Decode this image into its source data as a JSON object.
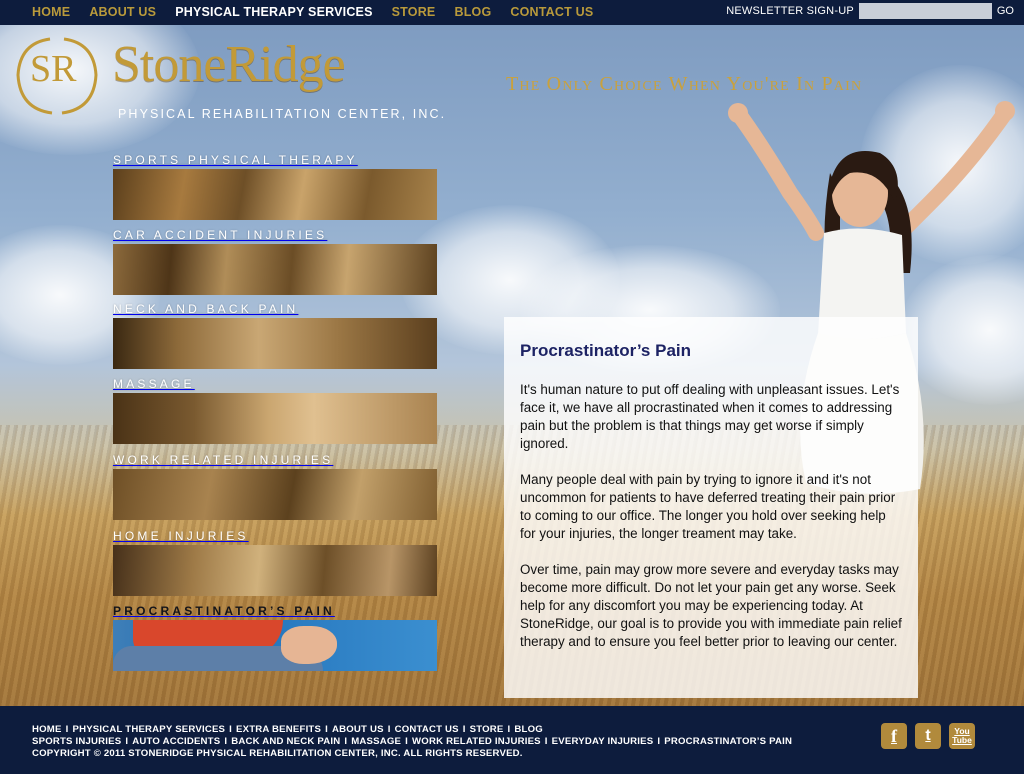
{
  "nav": {
    "items": [
      {
        "label": "HOME",
        "active": false
      },
      {
        "label": "ABOUT US",
        "active": false
      },
      {
        "label": "PHYSICAL THERAPY SERVICES",
        "active": true
      },
      {
        "label": "STORE",
        "active": false
      },
      {
        "label": "BLOG",
        "active": false
      },
      {
        "label": "CONTACT US",
        "active": false
      }
    ],
    "newsletter_label": "NEWSLETTER SIGN-UP",
    "newsletter_value": "",
    "go_label": "GO"
  },
  "brand": {
    "monogram": "SR",
    "name": "StoneRidge",
    "subtitle": "PHYSICAL REHABILITATION CENTER, INC.",
    "tagline": "The Only Choice When You're In Pain"
  },
  "services": [
    {
      "label": "SPORTS PHYSICAL THERAPY",
      "active": false
    },
    {
      "label": "CAR ACCIDENT INJURIES",
      "active": false
    },
    {
      "label": "NECK AND BACK PAIN",
      "active": false
    },
    {
      "label": "MASSAGE",
      "active": false
    },
    {
      "label": "WORK RELATED INJURIES",
      "active": false
    },
    {
      "label": "HOME INJURIES",
      "active": false
    },
    {
      "label": "PROCRASTINATOR’S PAIN",
      "active": true
    }
  ],
  "content": {
    "title": "Procrastinator’s Pain",
    "paragraphs": [
      "It's human nature to put off dealing with unpleasant issues. Let's face it, we have all procrastinated when it comes to addressing pain but the problem is that things may get worse if simply ignored.",
      "Many people deal with pain by trying to ignore it and it's not uncommon for patients to have deferred treating their pain prior to coming to our office. The longer you hold over seeking help for your injuries, the longer treament may take.",
      "Over time, pain may grow more severe and everyday tasks may become more difficult. Do not let your pain get any worse. Seek help for any discomfort you may be experiencing today. At StoneRidge, our goal is to provide you with immediate pain relief therapy and to ensure you feel better prior to leaving our center."
    ]
  },
  "footer": {
    "links_row1": [
      "HOME",
      "PHYSICAL THERAPY SERVICES",
      "EXTRA BENEFITS",
      "ABOUT US",
      "CONTACT US",
      "STORE",
      "BLOG"
    ],
    "links_row2": [
      "SPORTS INJURIES",
      "AUTO ACCIDENTS",
      "BACK AND NECK PAIN",
      "MASSAGE",
      "WORK RELATED INJURIES",
      "EVERYDAY INJURIES",
      "PROCRASTINATOR’S PAIN"
    ],
    "separator": "I",
    "copyright": "COPYRIGHT © 2011 STONERIDGE PHYSICAL REHABILITATION CENTER, INC. ALL RIGHTS RESERVED.",
    "social": [
      {
        "name": "facebook-icon",
        "glyph": "f"
      },
      {
        "name": "twitter-icon",
        "glyph": "t"
      },
      {
        "name": "youtube-icon",
        "glyph_top": "You",
        "glyph_bottom": "Tube"
      }
    ]
  },
  "colors": {
    "navy": "#0d1c3d",
    "gold": "#b99a3b",
    "title_navy": "#1d2364",
    "social_gold": "#b18a3c"
  }
}
